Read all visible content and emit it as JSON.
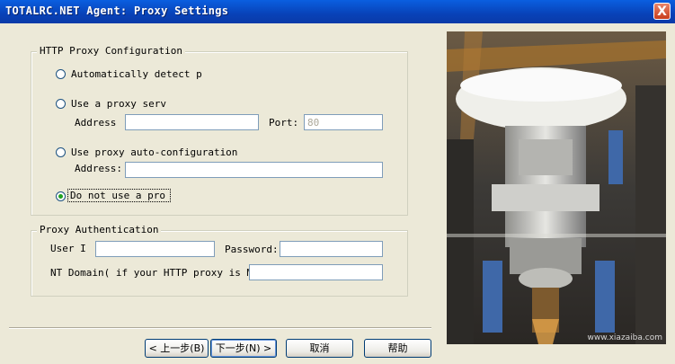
{
  "window": {
    "title": "TOTALRC.NET Agent: Proxy Settings",
    "close_glyph": "X"
  },
  "http_group": {
    "legend": "HTTP Proxy Configuration",
    "auto_detect_label": "Automatically detect p",
    "use_proxy_label": "Use a proxy serv",
    "address_label": "Address",
    "address_value": "",
    "port_label": "Port:",
    "port_value": "80",
    "auto_config_label": "Use proxy auto-configuration",
    "auto_config_address_label": "Address:",
    "auto_config_address_value": "",
    "no_proxy_label": "Do not use a pro",
    "selected_option": "no_proxy"
  },
  "auth_group": {
    "legend": "Proxy Authentication",
    "user_label": "User Id:",
    "user_value": "",
    "password_label": "Password:",
    "password_value": "",
    "domain_label": "NT Domain( if your HTTP proxy is MS",
    "domain_value": ""
  },
  "buttons": {
    "back": "< 上一步(B)",
    "next": "下一步(N) >",
    "cancel": "取消",
    "help": "帮助"
  },
  "watermark": "www.xiazaiba.com"
}
